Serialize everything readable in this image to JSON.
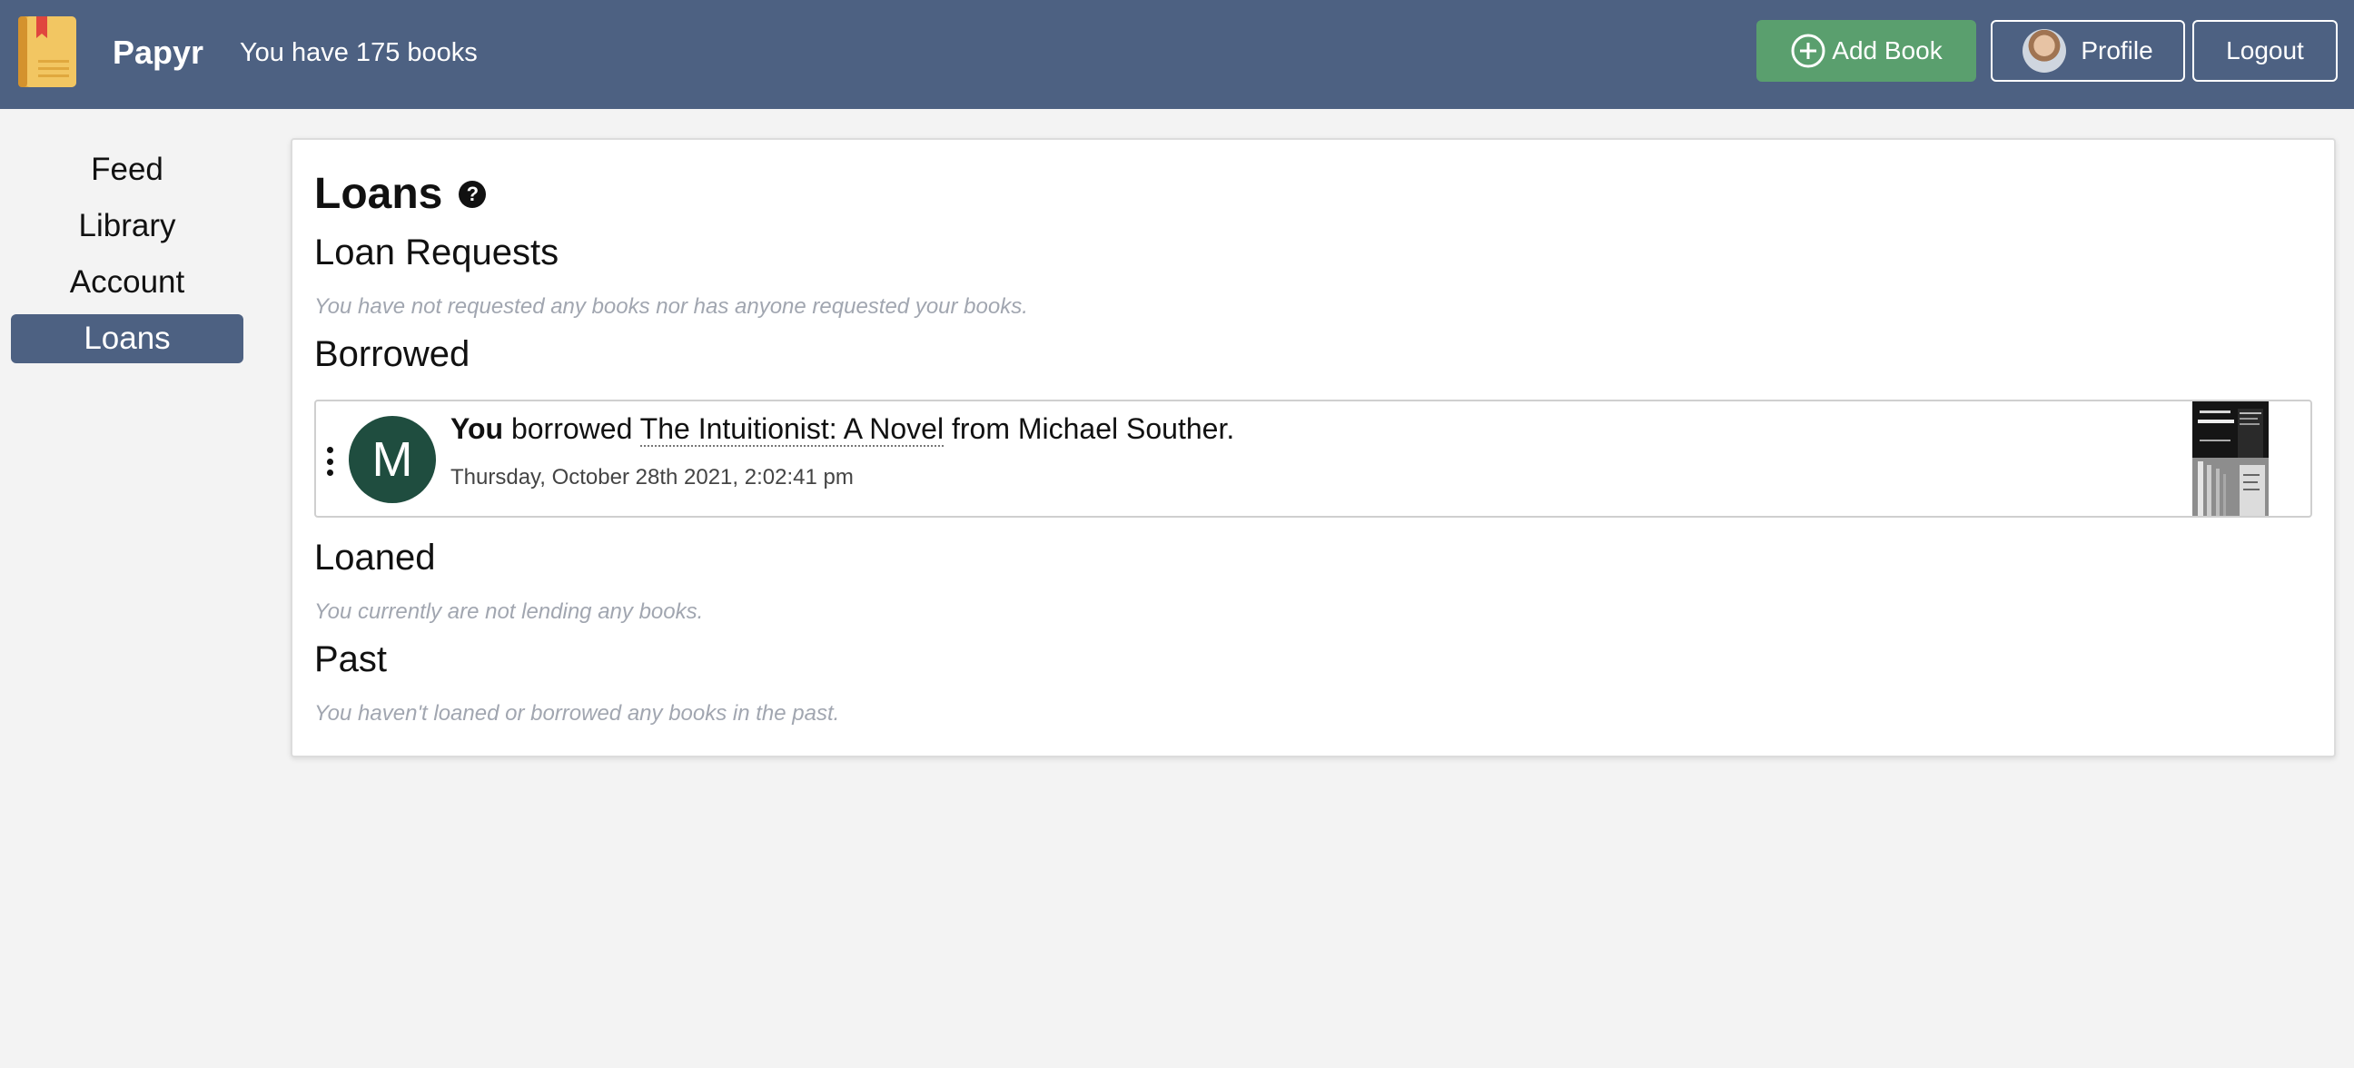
{
  "header": {
    "brand": "Papyr",
    "book_count_text": "You have 175 books",
    "add_book_label": "Add Book",
    "profile_label": "Profile",
    "logout_label": "Logout",
    "colors": {
      "navbar": "#4d6182",
      "add_button": "#5a9f6e"
    }
  },
  "sidebar": {
    "items": [
      {
        "label": "Feed",
        "active": false
      },
      {
        "label": "Library",
        "active": false
      },
      {
        "label": "Account",
        "active": false
      },
      {
        "label": "Loans",
        "active": true
      }
    ]
  },
  "main": {
    "title": "Loans",
    "help_icon": "question-circle-icon",
    "sections": {
      "loan_requests": {
        "heading": "Loan Requests",
        "empty_text": "You have not requested any books nor has anyone requested your books."
      },
      "borrowed": {
        "heading": "Borrowed",
        "items": [
          {
            "avatar_letter": "M",
            "subject": "You",
            "verb": "borrowed",
            "book_title": "The Intuitionist: A Novel",
            "from_text": "from Michael Souther.",
            "timestamp": "Thursday, October 28th 2021, 2:02:41 pm",
            "avatar_color": "#1f4d3f"
          }
        ]
      },
      "loaned": {
        "heading": "Loaned",
        "empty_text": "You currently are not lending any books."
      },
      "past": {
        "heading": "Past",
        "empty_text": "You haven't loaned or borrowed any books in the past."
      }
    }
  }
}
